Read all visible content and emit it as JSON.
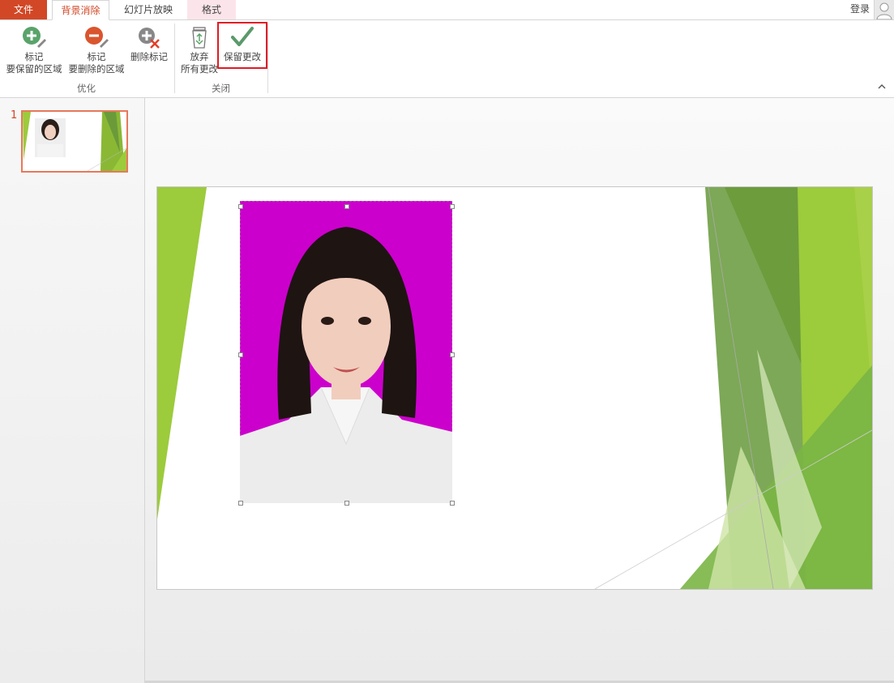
{
  "tabs": {
    "file": "文件",
    "background_removal": "背景消除",
    "slideshow": "幻灯片放映",
    "format": "格式"
  },
  "account": {
    "login": "登录"
  },
  "ribbon": {
    "refine_group": "优化",
    "close_group": "关闭",
    "mark_keep": {
      "line1": "标记",
      "line2": "要保留的区域"
    },
    "mark_remove": {
      "line1": "标记",
      "line2": "要删除的区域"
    },
    "delete_mark": "删除标记",
    "discard": {
      "line1": "放弃",
      "line2": "所有更改"
    },
    "keep_changes": "保留更改"
  },
  "slides": {
    "current_number": "1"
  },
  "colors": {
    "accent": "#d24726",
    "photo_bg": "#cc00cc",
    "green_dark": "#6a9a3a",
    "green_light": "#9ccb3c",
    "highlight": "#e01b24"
  }
}
